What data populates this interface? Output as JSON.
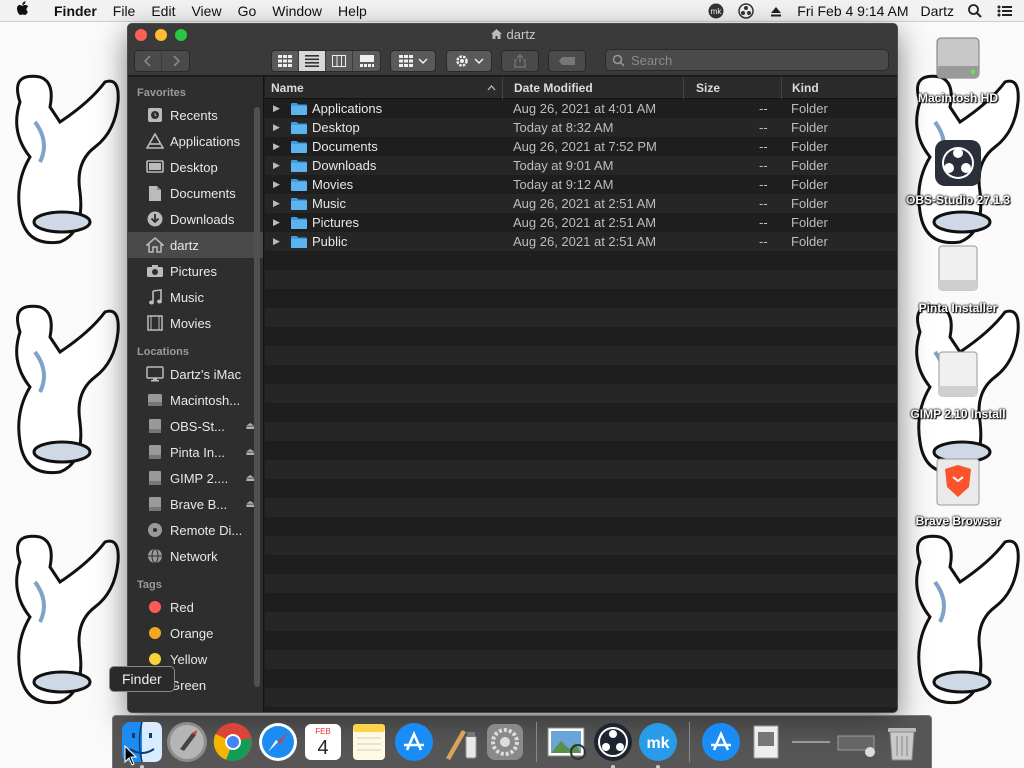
{
  "menubar": {
    "apple_icon": "apple-icon",
    "app_name": "Finder",
    "menus": [
      "File",
      "Edit",
      "View",
      "Go",
      "Window",
      "Help"
    ],
    "clock": "Fri Feb 4  9:14 AM",
    "user": "Dartz"
  },
  "window": {
    "title": "dartz",
    "search_placeholder": "Search"
  },
  "sidebar": {
    "favorites_header": "Favorites",
    "favorites": [
      {
        "label": "Recents",
        "icon": "clock-icon"
      },
      {
        "label": "Applications",
        "icon": "applications-icon"
      },
      {
        "label": "Desktop",
        "icon": "desktop-icon"
      },
      {
        "label": "Documents",
        "icon": "document-icon"
      },
      {
        "label": "Downloads",
        "icon": "download-icon"
      },
      {
        "label": "dartz",
        "icon": "home-icon"
      },
      {
        "label": "Pictures",
        "icon": "camera-icon"
      },
      {
        "label": "Music",
        "icon": "music-note-icon"
      },
      {
        "label": "Movies",
        "icon": "film-icon"
      }
    ],
    "locations_header": "Locations",
    "locations": [
      {
        "label": "Dartz's iMac",
        "icon": "imac-icon",
        "eject": false
      },
      {
        "label": "Macintosh...",
        "icon": "hard-drive-icon",
        "eject": false
      },
      {
        "label": "OBS-St...",
        "icon": "disk-icon",
        "eject": true
      },
      {
        "label": "Pinta In...",
        "icon": "disk-icon",
        "eject": true
      },
      {
        "label": "GIMP 2....",
        "icon": "disk-icon",
        "eject": true
      },
      {
        "label": "Brave B...",
        "icon": "disk-icon",
        "eject": true
      },
      {
        "label": "Remote Di...",
        "icon": "optical-disc-icon",
        "eject": false
      },
      {
        "label": "Network",
        "icon": "globe-icon",
        "eject": false
      }
    ],
    "tags_header": "Tags",
    "tags": [
      {
        "label": "Red",
        "color": "#fe5b57"
      },
      {
        "label": "Orange",
        "color": "#f5a623"
      },
      {
        "label": "Yellow",
        "color": "#f8d23a"
      },
      {
        "label": "Green",
        "color": "#3fc94f"
      }
    ]
  },
  "list": {
    "columns": {
      "name": "Name",
      "date": "Date Modified",
      "size": "Size",
      "kind": "Kind"
    },
    "rows": [
      {
        "name": "Applications",
        "date": "Aug 26, 2021 at 4:01 AM",
        "size": "--",
        "kind": "Folder"
      },
      {
        "name": "Desktop",
        "date": "Today at 8:32 AM",
        "size": "--",
        "kind": "Folder"
      },
      {
        "name": "Documents",
        "date": "Aug 26, 2021 at 7:52 PM",
        "size": "--",
        "kind": "Folder"
      },
      {
        "name": "Downloads",
        "date": "Today at 9:01 AM",
        "size": "--",
        "kind": "Folder"
      },
      {
        "name": "Movies",
        "date": "Today at 9:12 AM",
        "size": "--",
        "kind": "Folder"
      },
      {
        "name": "Music",
        "date": "Aug 26, 2021 at 2:51 AM",
        "size": "--",
        "kind": "Folder"
      },
      {
        "name": "Pictures",
        "date": "Aug 26, 2021 at 2:51 AM",
        "size": "--",
        "kind": "Folder"
      },
      {
        "name": "Public",
        "date": "Aug 26, 2021 at 2:51 AM",
        "size": "--",
        "kind": "Folder"
      }
    ]
  },
  "desktop": {
    "icons": [
      {
        "label": "Macintosh HD",
        "icon": "hard-drive-icon"
      },
      {
        "label": "OBS-Studio 27.1.3",
        "icon": "obs-icon"
      },
      {
        "label": "Pinta Installer",
        "icon": "external-drive-icon"
      },
      {
        "label": "GIMP 2.10 Install",
        "icon": "external-drive-icon"
      },
      {
        "label": "Brave Browser",
        "icon": "brave-icon"
      }
    ]
  },
  "dock": {
    "tooltip": "Finder",
    "calendar_month": "FEB",
    "calendar_day": "4"
  }
}
